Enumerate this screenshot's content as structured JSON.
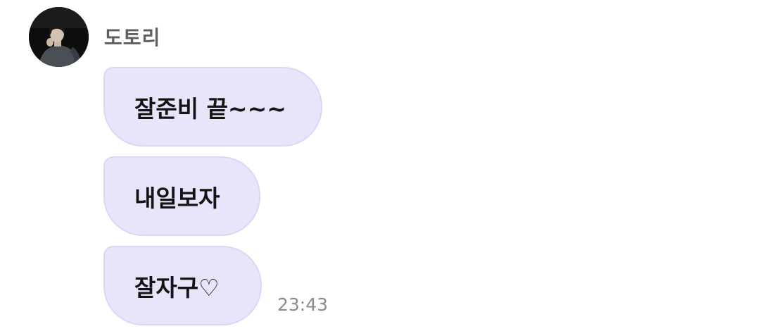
{
  "sender": {
    "name": "도토리"
  },
  "messages": [
    {
      "text": "잘준비 끝~~~"
    },
    {
      "text": "내일보자"
    },
    {
      "text": "잘자구♡"
    }
  ],
  "timestamp": "23:43",
  "colors": {
    "bubble_fill": "#e8e5fb",
    "bubble_border": "#dbd6f5",
    "sender_text": "#5f5f5f",
    "timestamp_text": "#8c8c8c"
  }
}
